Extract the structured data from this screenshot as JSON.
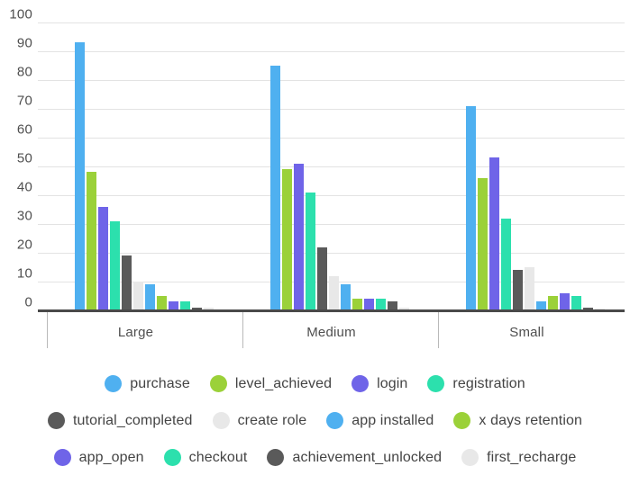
{
  "chart_data": {
    "type": "bar",
    "title": "",
    "subtitle": "",
    "xlabel": "",
    "ylabel": "",
    "ylim": [
      0,
      100
    ],
    "ytick_step": 10,
    "yticks": [
      100,
      90,
      80,
      70,
      60,
      50,
      40,
      30,
      20,
      10,
      0
    ],
    "grid": true,
    "legend_position": "bottom",
    "categories": [
      "Large",
      "Medium",
      "Small"
    ],
    "series": [
      {
        "name": "purchase",
        "color": "#4fb0f0",
        "values": [
          93,
          85,
          71
        ]
      },
      {
        "name": "level_achieved",
        "color": "#9bd139",
        "values": [
          48,
          49,
          46
        ]
      },
      {
        "name": "login",
        "color": "#6f64e8",
        "values": [
          36,
          51,
          53
        ]
      },
      {
        "name": "registration",
        "color": "#2ce0ad",
        "values": [
          31,
          41,
          32
        ]
      },
      {
        "name": "tutorial_completed",
        "color": "#5a5a5a",
        "values": [
          19,
          22,
          14
        ]
      },
      {
        "name": "create role",
        "color": "#e8e8e8",
        "values": [
          10,
          12,
          15
        ]
      },
      {
        "name": "app installed",
        "color": "#4fb0f0",
        "values": [
          9,
          9,
          3
        ]
      },
      {
        "name": "x days retention",
        "color": "#9bd139",
        "values": [
          5,
          4,
          5
        ]
      },
      {
        "name": "app_open",
        "color": "#6f64e8",
        "values": [
          3,
          4,
          6
        ]
      },
      {
        "name": "checkout",
        "color": "#2ce0ad",
        "values": [
          3,
          4,
          5
        ]
      },
      {
        "name": "achievement_unlocked",
        "color": "#5a5a5a",
        "values": [
          1,
          3,
          1
        ]
      },
      {
        "name": "first_recharge",
        "color": "#e8e8e8",
        "values": [
          1,
          1,
          0.5
        ]
      }
    ]
  },
  "legend": {
    "rows": [
      [
        {
          "label": "purchase",
          "color": "#4fb0f0",
          "icon": "legend-dot-icon"
        },
        {
          "label": "level_achieved",
          "color": "#9bd139",
          "icon": "legend-dot-icon"
        },
        {
          "label": "login",
          "color": "#6f64e8",
          "icon": "legend-dot-icon"
        },
        {
          "label": "registration",
          "color": "#2ce0ad",
          "icon": "legend-dot-icon"
        }
      ],
      [
        {
          "label": "tutorial_completed",
          "color": "#5a5a5a",
          "icon": "legend-dot-icon"
        },
        {
          "label": "create role",
          "color": "#e8e8e8",
          "icon": "legend-dot-icon"
        },
        {
          "label": "app installed",
          "color": "#4fb0f0",
          "icon": "legend-dot-icon"
        },
        {
          "label": "x days retention",
          "color": "#9bd139",
          "icon": "legend-dot-icon"
        }
      ],
      [
        {
          "label": "app_open",
          "color": "#6f64e8",
          "icon": "legend-dot-icon"
        },
        {
          "label": "checkout",
          "color": "#2ce0ad",
          "icon": "legend-dot-icon"
        },
        {
          "label": "achievement_unlocked",
          "color": "#5a5a5a",
          "icon": "legend-dot-icon"
        },
        {
          "label": "first_recharge",
          "color": "#e8e8e8",
          "icon": "legend-dot-icon"
        }
      ]
    ]
  },
  "style": {
    "gridline_color": "#e3e3e3",
    "axis_color": "#4a4a4a",
    "tick_label_color": "#4f4f4f",
    "background": "#ffffff"
  }
}
